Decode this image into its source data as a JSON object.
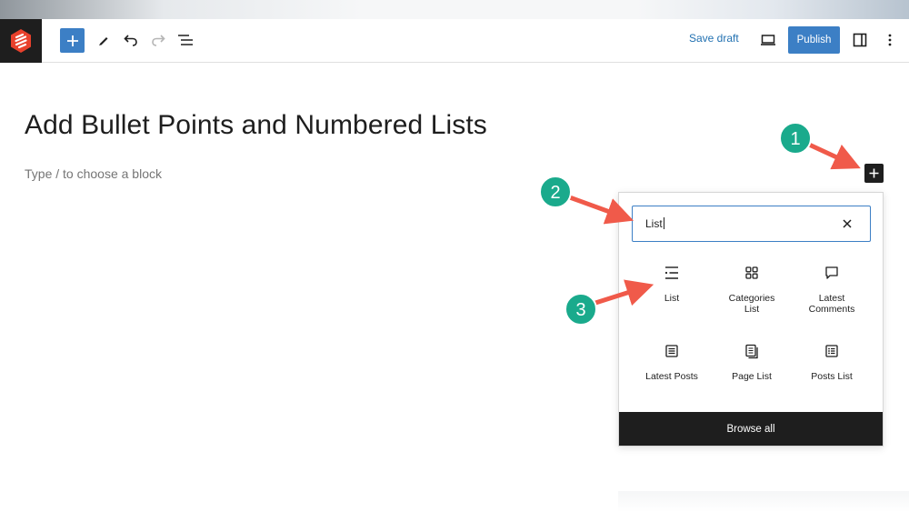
{
  "toolbar": {
    "save_draft_label": "Save draft",
    "publish_label": "Publish",
    "icons": [
      "wp-logo-icon",
      "plus-icon",
      "pencil-icon",
      "undo-icon",
      "redo-icon",
      "list-view-icon",
      "desktop-preview-icon",
      "sidebar-toggle-icon",
      "more-vertical-icon"
    ]
  },
  "editor": {
    "post_title": "Add Bullet Points and Numbered Lists",
    "block_placeholder": "Type / to choose a block"
  },
  "inserter": {
    "search_value": "List",
    "blocks": [
      {
        "label": "List",
        "icon": "list-icon"
      },
      {
        "label": "Categories List",
        "icon": "categories-icon"
      },
      {
        "label": "Latest Comments",
        "icon": "comment-icon"
      },
      {
        "label": "Latest Posts",
        "icon": "post-list-icon"
      },
      {
        "label": "Page List",
        "icon": "page-list-icon"
      },
      {
        "label": "Posts List",
        "icon": "posts-list-icon"
      }
    ],
    "browse_all_label": "Browse all"
  },
  "annotations": {
    "badges": [
      "1",
      "2",
      "3"
    ],
    "badge_color": "#1aaa8c",
    "arrow_color": "#f05a4a"
  },
  "colors": {
    "accent": "#3c7fc5",
    "dark": "#1e1e1e",
    "link": "#2271b1"
  }
}
